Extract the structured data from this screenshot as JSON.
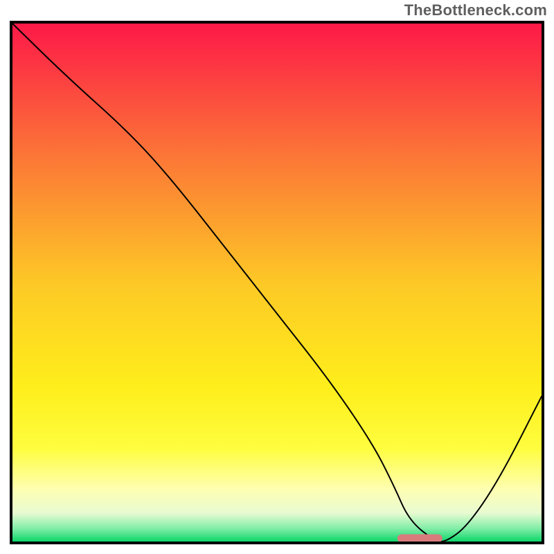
{
  "watermark": "TheBottleneck.com",
  "chart_data": {
    "type": "line",
    "title": "",
    "xlabel": "",
    "ylabel": "",
    "xlim": [
      0,
      100
    ],
    "ylim": [
      0,
      100
    ],
    "grid": false,
    "legend": false,
    "annotations": [],
    "background_gradient_stops": [
      {
        "offset": 0.0,
        "color": "#fd1948"
      },
      {
        "offset": 0.25,
        "color": "#fc7437"
      },
      {
        "offset": 0.5,
        "color": "#fdc826"
      },
      {
        "offset": 0.7,
        "color": "#feee1b"
      },
      {
        "offset": 0.82,
        "color": "#fefd3e"
      },
      {
        "offset": 0.9,
        "color": "#fefeb3"
      },
      {
        "offset": 0.945,
        "color": "#e8fbd1"
      },
      {
        "offset": 0.975,
        "color": "#80eda7"
      },
      {
        "offset": 1.0,
        "color": "#0cd669"
      }
    ],
    "series": [
      {
        "name": "curve",
        "color": "#000000",
        "width": 2,
        "x": [
          0,
          10,
          22,
          30,
          40,
          50,
          60,
          68,
          72,
          75,
          80,
          82,
          86,
          92,
          100
        ],
        "y": [
          100,
          90,
          79,
          70,
          57,
          44,
          31,
          19,
          11,
          4,
          0,
          0,
          3,
          12,
          28
        ]
      }
    ],
    "marker": {
      "name": "min-marker",
      "color": "#d97b7d",
      "x_center": 77,
      "y": 0.6,
      "width": 8.5,
      "height": 1.6,
      "rx": 0.9
    }
  }
}
